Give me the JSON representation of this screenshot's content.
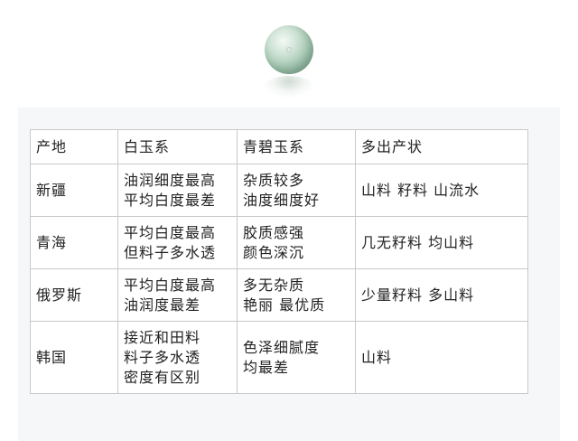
{
  "header_image": {
    "icon": "jade-bead-icon"
  },
  "table": {
    "headers": [
      "产地",
      "白玉系",
      "青碧玉系",
      "多出产状"
    ],
    "rows": [
      {
        "origin": "新疆",
        "white_jade": [
          "油润细度最高",
          "平均白度最差"
        ],
        "green_jade": [
          "杂质较多",
          "油度细度好"
        ],
        "forms": "山料  籽料  山流水"
      },
      {
        "origin": "青海",
        "white_jade": [
          "平均白度最高",
          "但料子多水透"
        ],
        "green_jade": [
          "胶质感强",
          "颜色深沉"
        ],
        "forms": "几无籽料  均山料"
      },
      {
        "origin": "俄罗斯",
        "white_jade": [
          "平均白度最高",
          "油润度最差"
        ],
        "green_jade": [
          "多无杂质",
          "艳丽  最优质"
        ],
        "forms": "少量籽料  多山料"
      },
      {
        "origin": "韩国",
        "white_jade": [
          "接近和田料",
          "料子多水透",
          "密度有区别"
        ],
        "green_jade": [
          "色泽细腻度",
          "均最差"
        ],
        "forms": "山料"
      }
    ]
  }
}
